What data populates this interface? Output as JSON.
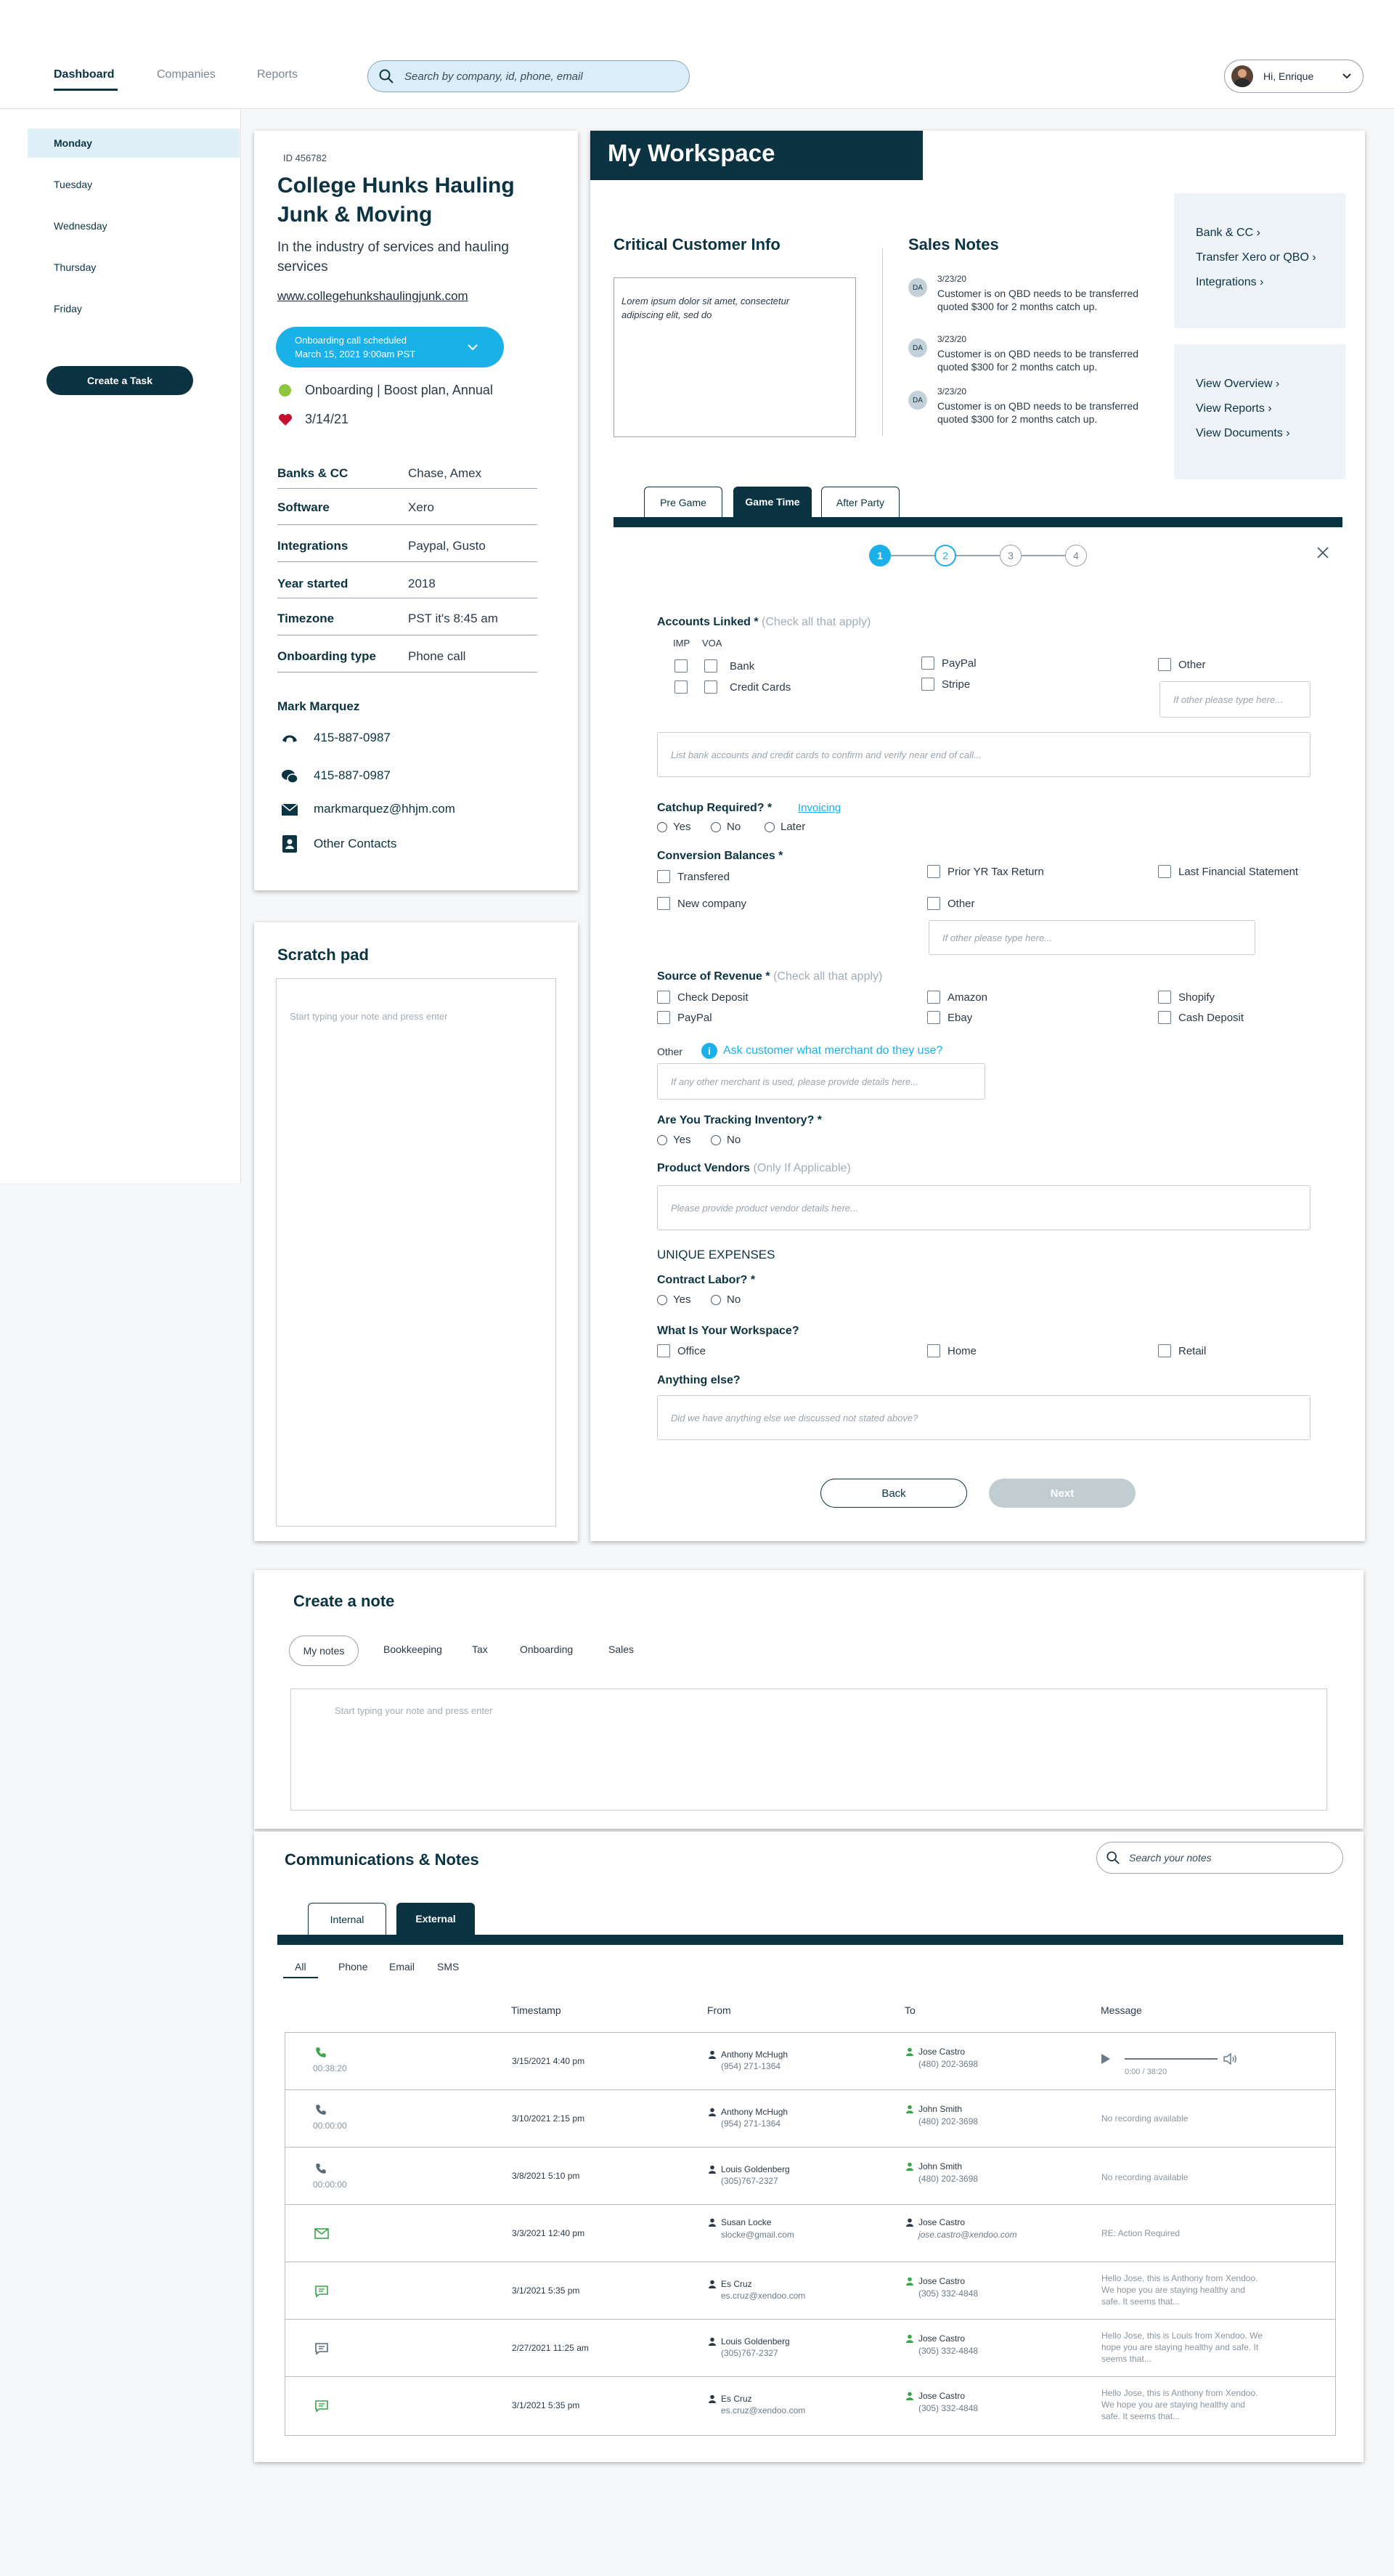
{
  "nav": {
    "tabs": [
      "Dashboard",
      "Companies",
      "Reports"
    ],
    "search_placeholder": "Search by company, id, phone, email",
    "user_greeting": "Hi, Enrique"
  },
  "sidebar": {
    "days": [
      "Monday",
      "Tuesday",
      "Wednesday",
      "Thursday",
      "Friday"
    ],
    "create_task": "Create a Task"
  },
  "company": {
    "id": "ID 456782",
    "name": "College Hunks Hauling Junk & Moving",
    "industry": "In the industry of services and hauling services",
    "website": "www.collegehunkshaulingjunk.com",
    "onboarding_call_line1": "Onboarding call scheduled",
    "onboarding_call_line2": "March 15, 2021  9:00am PST",
    "status": "Onboarding | Boost plan, Annual",
    "date": "3/14/21",
    "details": [
      {
        "label": "Banks & CC",
        "value": "Chase, Amex"
      },
      {
        "label": "Software",
        "value": "Xero"
      },
      {
        "label": "Integrations",
        "value": "Paypal, Gusto"
      },
      {
        "label": "Year started",
        "value": "2018"
      },
      {
        "label": "Timezone",
        "value": "PST it's 8:45 am"
      },
      {
        "label": "Onboarding type",
        "value": "Phone call"
      }
    ],
    "contact": {
      "name": "Mark Marquez",
      "phone": "415-887-0987",
      "sms": "415-887-0987",
      "email": "markmarquez@hhjm.com",
      "other": "Other Contacts"
    }
  },
  "scratch": {
    "title": "Scratch pad",
    "placeholder": "Start typing your note and press enter"
  },
  "workspace": {
    "title": "My Workspace",
    "critical_title": "Critical Customer Info",
    "critical_text": "Lorem ipsum dolor sit amet, consectetur adipiscing elit, sed do",
    "sales_title": "Sales Notes",
    "sales_notes": [
      {
        "initials": "DA",
        "date": "3/23/20",
        "text": "Customer is on QBD needs to be transferred quoted $300 for 2 months catch up."
      },
      {
        "initials": "DA",
        "date": "3/23/20",
        "text": "Customer is on QBD needs to be transferred quoted $300 for 2 months catch up."
      },
      {
        "initials": "DA",
        "date": "3/23/20",
        "text": "Customer is on QBD needs to be transferred quoted $300 for 2 months catch up."
      }
    ],
    "links_a": [
      "Bank & CC",
      "Transfer Xero or QBO",
      "Integrations"
    ],
    "links_b": [
      "View Overview",
      "View Reports",
      "View Documents"
    ],
    "tabs": [
      "Pre Game",
      "Game Time",
      "After Party"
    ],
    "steps": [
      "1",
      "2",
      "3",
      "4"
    ]
  },
  "form": {
    "accounts_linked": "Accounts Linked *",
    "check_all": "(Check all that apply)",
    "imp": "IMP",
    "voa": "VOA",
    "bank": "Bank",
    "credit_cards": "Credit Cards",
    "paypal": "PayPal",
    "stripe": "Stripe",
    "other": "Other",
    "other_placeholder": "If other please type here...",
    "accounts_placeholder": "List bank accounts and credit cards to confirm and verify near end of call...",
    "catchup": "Catchup Required? *",
    "invoicing": "Invoicing",
    "yes": "Yes",
    "no": "No",
    "later": "Later",
    "conversion": "Conversion Balances *",
    "transfered": "Transfered",
    "prior_yr": "Prior YR Tax Return",
    "last_fin": "Last Financial Statement",
    "new_company": "New company",
    "source": "Source of Revenue *",
    "check_deposit": "Check Deposit",
    "amazon": "Amazon",
    "shopify": "Shopify",
    "ebay": "Ebay",
    "cash_deposit": "Cash Deposit",
    "ask_merchant": "Ask customer what merchant do they use?",
    "merchant_placeholder": "If any other merchant is used, please provide details here...",
    "inventory": "Are You Tracking Inventory? *",
    "vendors": "Product Vendors",
    "if_applicable": "(Only If Applicable)",
    "vendors_placeholder": "Please provide product vendor details here...",
    "unique": "UNIQUE EXPENSES",
    "contract": "Contract Labor? *",
    "workspace_q": "What Is Your Workspace?",
    "office": "Office",
    "home": "Home",
    "retail": "Retail",
    "anything": "Anything else?",
    "anything_placeholder": "Did we have anything else we discussed not stated above?",
    "back": "Back",
    "next": "Next"
  },
  "create_note": {
    "title": "Create a note",
    "tabs": [
      "My notes",
      "Bookkeeping",
      "Tax",
      "Onboarding",
      "Sales"
    ],
    "placeholder": "Start typing your note and press enter"
  },
  "comms": {
    "title": "Communications & Notes",
    "search_placeholder": "Search your notes",
    "tabs": [
      "Internal",
      "External"
    ],
    "filters": [
      "All",
      "Phone",
      "Email",
      "SMS"
    ],
    "headers": [
      "Timestamp",
      "From",
      "To",
      "Message"
    ],
    "rows": [
      {
        "type": "phone-active",
        "duration": "00:38:20",
        "timestamp": "3/15/2021  4:40 pm",
        "from_name": "Anthony McHugh",
        "from_sub": "(954) 271-1364",
        "to_name": "Jose Castro",
        "to_sub": "(480) 202-3698",
        "message": "",
        "audio": "0:00 / 38:20"
      },
      {
        "type": "phone",
        "duration": "00:00:00",
        "timestamp": "3/10/2021  2:15 pm",
        "from_name": "Anthony McHugh",
        "from_sub": "(954) 271-1364",
        "to_name": "John Smith",
        "to_sub": "(480) 202-3698",
        "message": "No recording available"
      },
      {
        "type": "phone",
        "duration": "00:00:00",
        "timestamp": "3/8/2021  5:10 pm",
        "from_name": "Louis Goldenberg",
        "from_sub": "(305)767-2327",
        "to_name": "John Smith",
        "to_sub": "(480) 202-3698",
        "message": "No recording available"
      },
      {
        "type": "email",
        "duration": "",
        "timestamp": "3/3/2021  12:40 pm",
        "from_name": "Susan Locke",
        "from_sub": "slocke@gmail.com",
        "to_name": "Jose Castro",
        "to_sub": "jose.castro@xendoo.com",
        "message": "RE: Action Required"
      },
      {
        "type": "sms-active",
        "duration": "",
        "timestamp": "3/1/2021  5:35 pm",
        "from_name": "Es Cruz",
        "from_sub": "es.cruz@xendoo.com",
        "to_name": "Jose Castro",
        "to_sub": "(305) 332-4848",
        "message": "Hello Jose, this is Anthony from Xendoo. We hope you are staying healthy and safe. It seems that..."
      },
      {
        "type": "sms",
        "duration": "",
        "timestamp": "2/27/2021  11:25 am",
        "from_name": "Louis Goldenberg",
        "from_sub": "(305)767-2327",
        "to_name": "Jose Castro",
        "to_sub": "(305) 332-4848",
        "message": "Hello Jose, this is Louis from Xendoo. We hope you are staying healthy and safe. It seems that..."
      },
      {
        "type": "sms-active",
        "duration": "",
        "timestamp": "3/1/2021  5:35 pm",
        "from_name": "Es Cruz",
        "from_sub": "es.cruz@xendoo.com",
        "to_name": "Jose Castro",
        "to_sub": "(305) 332-4848",
        "message": "Hello Jose, this is Anthony from Xendoo. We hope you are staying healthy and safe. It seems that..."
      }
    ]
  },
  "colors": {
    "navy": "#0b3342",
    "accent": "#1ab0e8",
    "green": "#3aa54a",
    "sidebar_active": "#dff0f8"
  }
}
